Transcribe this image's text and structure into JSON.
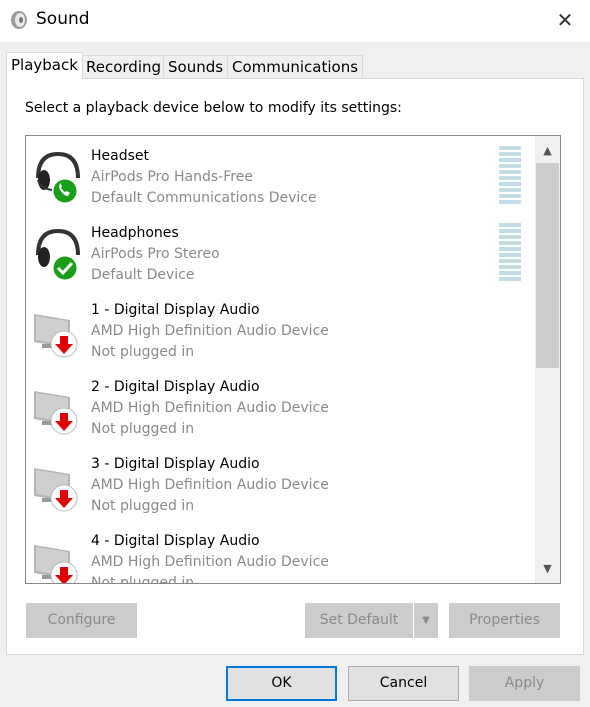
{
  "window": {
    "title": "Sound",
    "close_icon": "close-icon"
  },
  "tabs": [
    {
      "label": "Playback",
      "active": true
    },
    {
      "label": "Recording"
    },
    {
      "label": "Sounds"
    },
    {
      "label": "Communications"
    }
  ],
  "instruction": "Select a playback device below to modify its settings:",
  "devices": [
    {
      "name": "Headset",
      "description": "AirPods Pro Hands-Free",
      "status": "Default Communications Device",
      "icon": "headset-phone-icon",
      "badge_color": "#1a9e1a"
    },
    {
      "name": "Headphones",
      "description": "AirPods Pro Stereo",
      "status": "Default Device",
      "icon": "headphones-check-icon",
      "badge_color": "#1a9e1a"
    },
    {
      "name": "1 - Digital Display Audio",
      "description": "AMD High Definition Audio Device",
      "status": "Not plugged in",
      "icon": "monitor-unplugged-icon",
      "badge_color": "#e00000"
    },
    {
      "name": "2 - Digital Display Audio",
      "description": "AMD High Definition Audio Device",
      "status": "Not plugged in",
      "icon": "monitor-unplugged-icon",
      "badge_color": "#e00000"
    },
    {
      "name": "3 - Digital Display Audio",
      "description": "AMD High Definition Audio Device",
      "status": "Not plugged in",
      "icon": "monitor-unplugged-icon",
      "badge_color": "#e00000"
    },
    {
      "name": "4 - Digital Display Audio",
      "description": "AMD High Definition Audio Device",
      "status": "Not plugged in",
      "icon": "monitor-unplugged-icon",
      "badge_color": "#e00000"
    }
  ],
  "buttons": {
    "configure": "Configure",
    "set_default": "Set Default",
    "properties": "Properties",
    "ok": "OK",
    "cancel": "Cancel",
    "apply": "Apply"
  }
}
